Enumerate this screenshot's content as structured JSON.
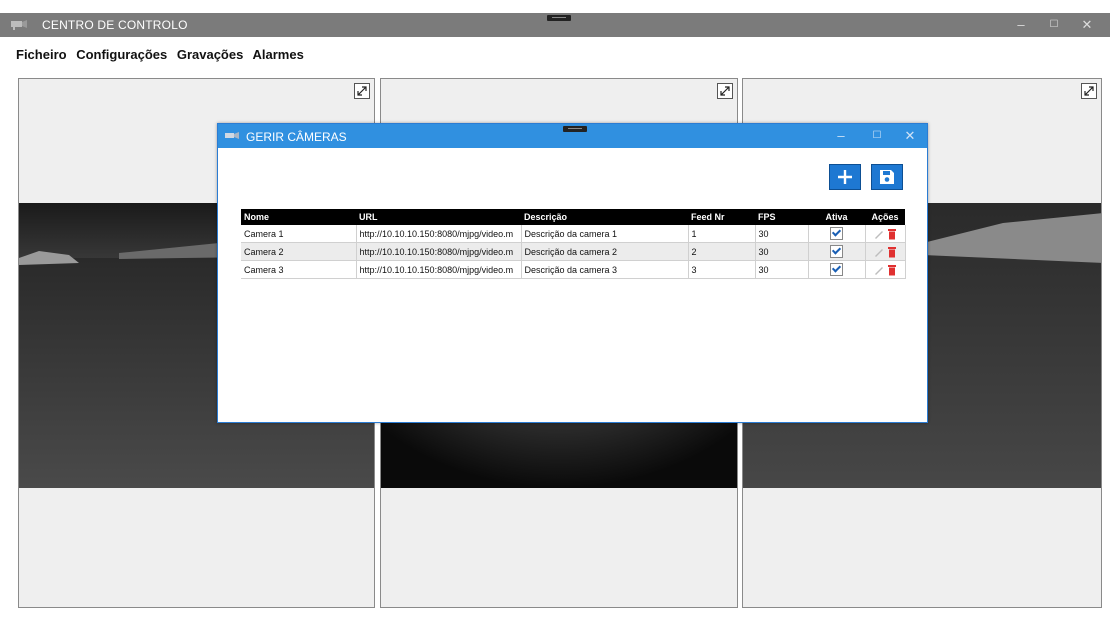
{
  "window": {
    "title": "CENTRO DE CONTROLO",
    "minimize": "–",
    "maximize": "☐",
    "close": "✕"
  },
  "menu": [
    "Ficheiro",
    "Configurações",
    "Gravações",
    "Alarmes"
  ],
  "dialog": {
    "title": "GERIR CÂMERAS",
    "minimize": "–",
    "maximize": "☐",
    "close": "✕",
    "add_icon": "plus-icon",
    "save_icon": "floppy-disk-icon",
    "columns": [
      "Nome",
      "URL",
      "Descrição",
      "Feed Nr",
      "FPS",
      "Ativa",
      "Ações"
    ],
    "rows": [
      {
        "name": "Camera 1",
        "url": "http://10.10.10.150:8080/mjpg/video.m",
        "desc": "Descrição da camera 1",
        "feed": "1",
        "fps": "30",
        "active": true
      },
      {
        "name": "Camera 2",
        "url": "http://10.10.10.150:8080/mjpg/video.m",
        "desc": "Descrição da camera 2",
        "feed": "2",
        "fps": "30",
        "active": true
      },
      {
        "name": "Camera 3",
        "url": "http://10.10.10.150:8080/mjpg/video.m",
        "desc": "Descrição da camera 3",
        "feed": "3",
        "fps": "30",
        "active": true
      }
    ]
  },
  "colors": {
    "titlebar": "#7b7b7b",
    "dialog_titlebar": "#3090e0",
    "button": "#1e78d2",
    "delete": "#e03030"
  }
}
